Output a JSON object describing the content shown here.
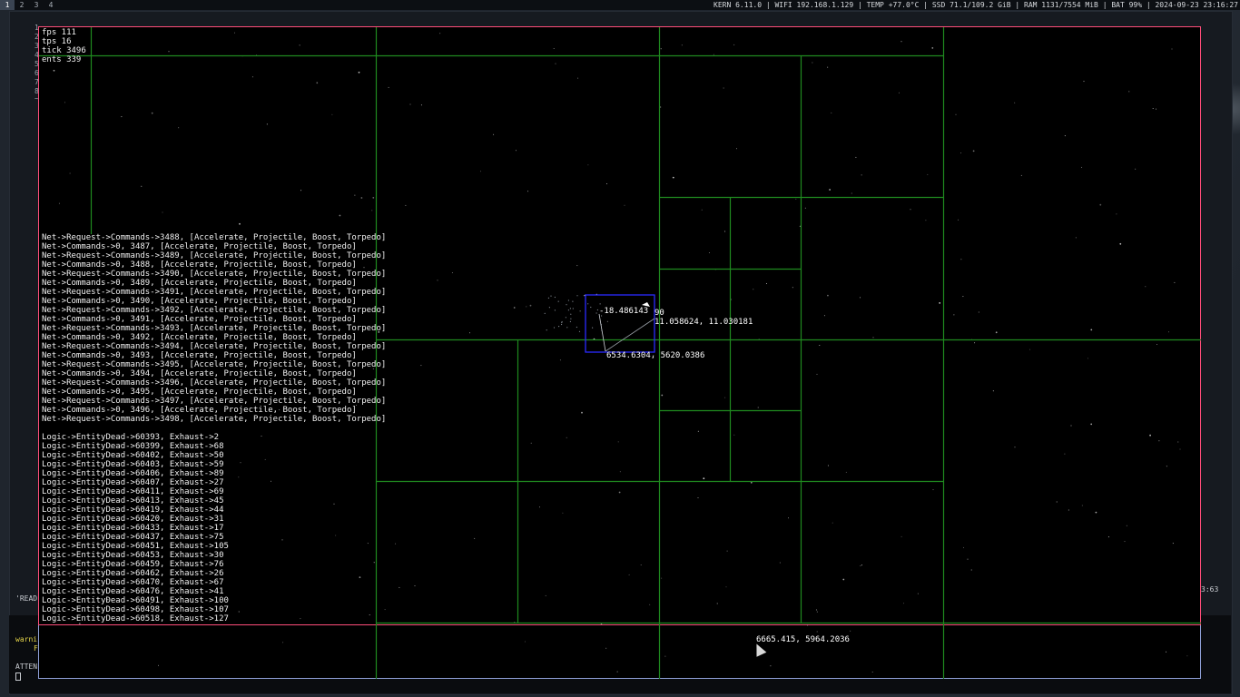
{
  "topbar": {
    "workspaces": [
      "1",
      "2",
      "3",
      "4"
    ],
    "status": "KERN 6.11.0 | WIFI 192.168.1.129 | TEMP +77.0°C | SSD 71.1/109.2 GiB | RAM 1131/7554 MiB | BAT 99% | 2024-09-23 23:16:27"
  },
  "background_terminal": {
    "line_numbers": [
      "1",
      "2",
      "3",
      "4",
      "5",
      "6",
      "7",
      "8",
      "~"
    ],
    "read_fragment": "'READ",
    "right_fragment": "3:63",
    "warn_fragment": "warni",
    "f_fragment": "F",
    "atten_fragment": "ATTEN"
  },
  "hud": {
    "fps": "fps 111",
    "tps": "tps 16",
    "tick": "tick 3496",
    "ents": "ents 339"
  },
  "net_log": [
    "Net->Request->Commands->3488, [Accelerate, Projectile, Boost, Torpedo]",
    "Net->Commands->0, 3487, [Accelerate, Projectile, Boost, Torpedo]",
    "Net->Request->Commands->3489, [Accelerate, Projectile, Boost, Torpedo]",
    "Net->Commands->0, 3488, [Accelerate, Projectile, Boost, Torpedo]",
    "Net->Request->Commands->3490, [Accelerate, Projectile, Boost, Torpedo]",
    "Net->Commands->0, 3489, [Accelerate, Projectile, Boost, Torpedo]",
    "Net->Request->Commands->3491, [Accelerate, Projectile, Boost, Torpedo]",
    "Net->Commands->0, 3490, [Accelerate, Projectile, Boost, Torpedo]",
    "Net->Request->Commands->3492, [Accelerate, Projectile, Boost, Torpedo]",
    "Net->Commands->0, 3491, [Accelerate, Projectile, Boost, Torpedo]",
    "Net->Request->Commands->3493, [Accelerate, Projectile, Boost, Torpedo]",
    "Net->Commands->0, 3492, [Accelerate, Projectile, Boost, Torpedo]",
    "Net->Request->Commands->3494, [Accelerate, Projectile, Boost, Torpedo]",
    "Net->Commands->0, 3493, [Accelerate, Projectile, Boost, Torpedo]",
    "Net->Request->Commands->3495, [Accelerate, Projectile, Boost, Torpedo]",
    "Net->Commands->0, 3494, [Accelerate, Projectile, Boost, Torpedo]",
    "Net->Request->Commands->3496, [Accelerate, Projectile, Boost, Torpedo]",
    "Net->Commands->0, 3495, [Accelerate, Projectile, Boost, Torpedo]",
    "Net->Request->Commands->3497, [Accelerate, Projectile, Boost, Torpedo]",
    "Net->Commands->0, 3496, [Accelerate, Projectile, Boost, Torpedo]",
    "Net->Request->Commands->3498, [Accelerate, Projectile, Boost, Torpedo]"
  ],
  "logic_log": [
    "Logic->EntityDead->60393, Exhaust->2",
    "Logic->EntityDead->60399, Exhaust->68",
    "Logic->EntityDead->60402, Exhaust->50",
    "Logic->EntityDead->60403, Exhaust->59",
    "Logic->EntityDead->60406, Exhaust->89",
    "Logic->EntityDead->60407, Exhaust->27",
    "Logic->EntityDead->60411, Exhaust->69",
    "Logic->EntityDead->60413, Exhaust->45",
    "Logic->EntityDead->60419, Exhaust->44",
    "Logic->EntityDead->60420, Exhaust->31",
    "Logic->EntityDead->60433, Exhaust->17",
    "Logic->EntityDead->60437, Exhaust->75",
    "Logic->EntityDead->60451, Exhaust->105",
    "Logic->EntityDead->60453, Exhaust->30",
    "Logic->EntityDead->60459, Exhaust->76",
    "Logic->EntityDead->60462, Exhaust->26",
    "Logic->EntityDead->60470, Exhaust->67",
    "Logic->EntityDead->60476, Exhaust->41",
    "Logic->EntityDead->60491, Exhaust->100",
    "Logic->EntityDead->60498, Exhaust->107",
    "Logic->EntityDead->60518, Exhaust->127"
  ],
  "world": {
    "player_rotation": "-18.486143",
    "player_angle_marker": "90",
    "player_velocity": "11.058624, 11.030181",
    "player_position": "6534.6304, 5620.0386",
    "cursor_world_position": "6665.415, 5964.2036"
  },
  "colors": {
    "grid": "#1f8a1f",
    "game_border": "#ff4d7a",
    "player_box": "#2a2aff",
    "text": "#f0f0f0"
  }
}
